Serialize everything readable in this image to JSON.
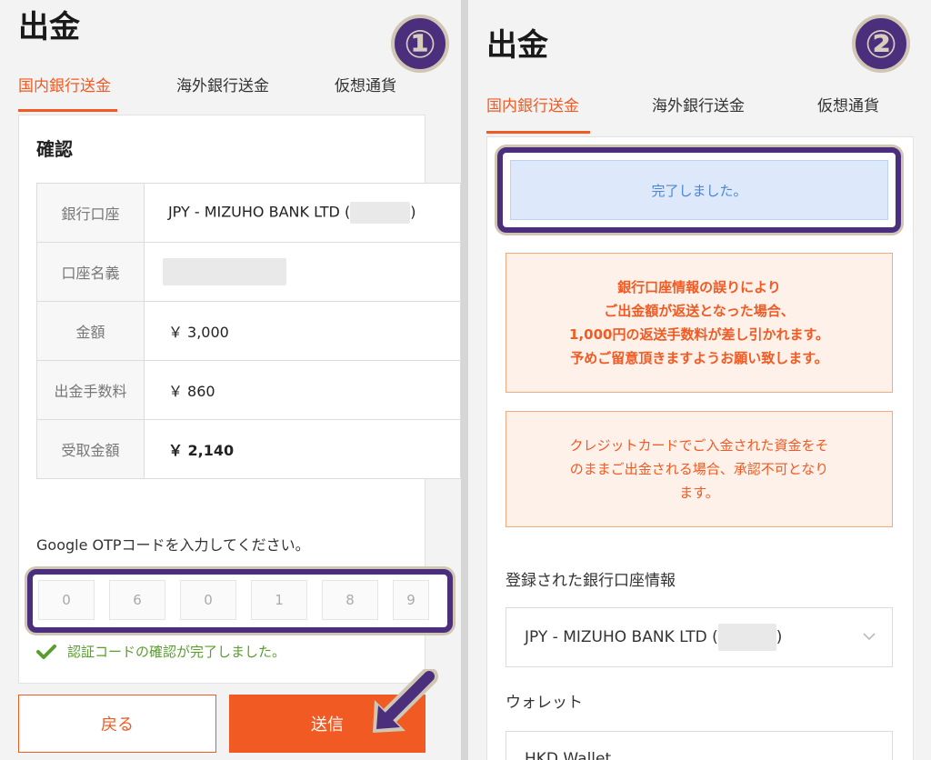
{
  "left": {
    "title": "出金",
    "step_badge": "①",
    "tabs": [
      "国内銀行送金",
      "海外銀行送金",
      "仮想通貨"
    ],
    "card_title": "確認",
    "rows": [
      {
        "label": "銀行口座",
        "value": "JPY - MIZUHO BANK LTD (",
        "suffix": ")"
      },
      {
        "label": "口座名義",
        "value": ""
      },
      {
        "label": "金額",
        "value": "￥ 3,000"
      },
      {
        "label": "出金手数料",
        "value": "￥ 860"
      },
      {
        "label": "受取金額",
        "value": "￥ 2,140"
      }
    ],
    "otp_label": "Google OTPコードを入力してください。",
    "otp_digits": [
      "0",
      "6",
      "0",
      "1",
      "8",
      "9"
    ],
    "verify_message": "認証コードの確認が完了しました。",
    "back_button": "戻る",
    "send_button": "送信"
  },
  "right": {
    "title": "出金",
    "step_badge": "②",
    "tabs": [
      "国内銀行送金",
      "海外銀行送金",
      "仮想通貨"
    ],
    "done_message": "完了しました。",
    "notice1": [
      "銀行口座情報の誤りにより",
      "ご出金額が返送となった場合、",
      "1,000円の返送手数料が差し引かれます。",
      "予めご留意頂きますようお願い致します。"
    ],
    "notice2": [
      "クレジットカードでご入金された資金をそ",
      "のままご出金される場合、承認不可となり",
      "ます。"
    ],
    "bank_section_label": "登録された銀行口座情報",
    "bank_select_value": "JPY - MIZUHO BANK LTD (",
    "bank_select_suffix": ")",
    "wallet_label": "ウォレット",
    "wallet_select_value": "HKD Wallet"
  },
  "colors": {
    "accent": "#f15a22",
    "highlight": "#4b2f7d",
    "success": "#5a9d2f",
    "info": "#4a86d6"
  }
}
